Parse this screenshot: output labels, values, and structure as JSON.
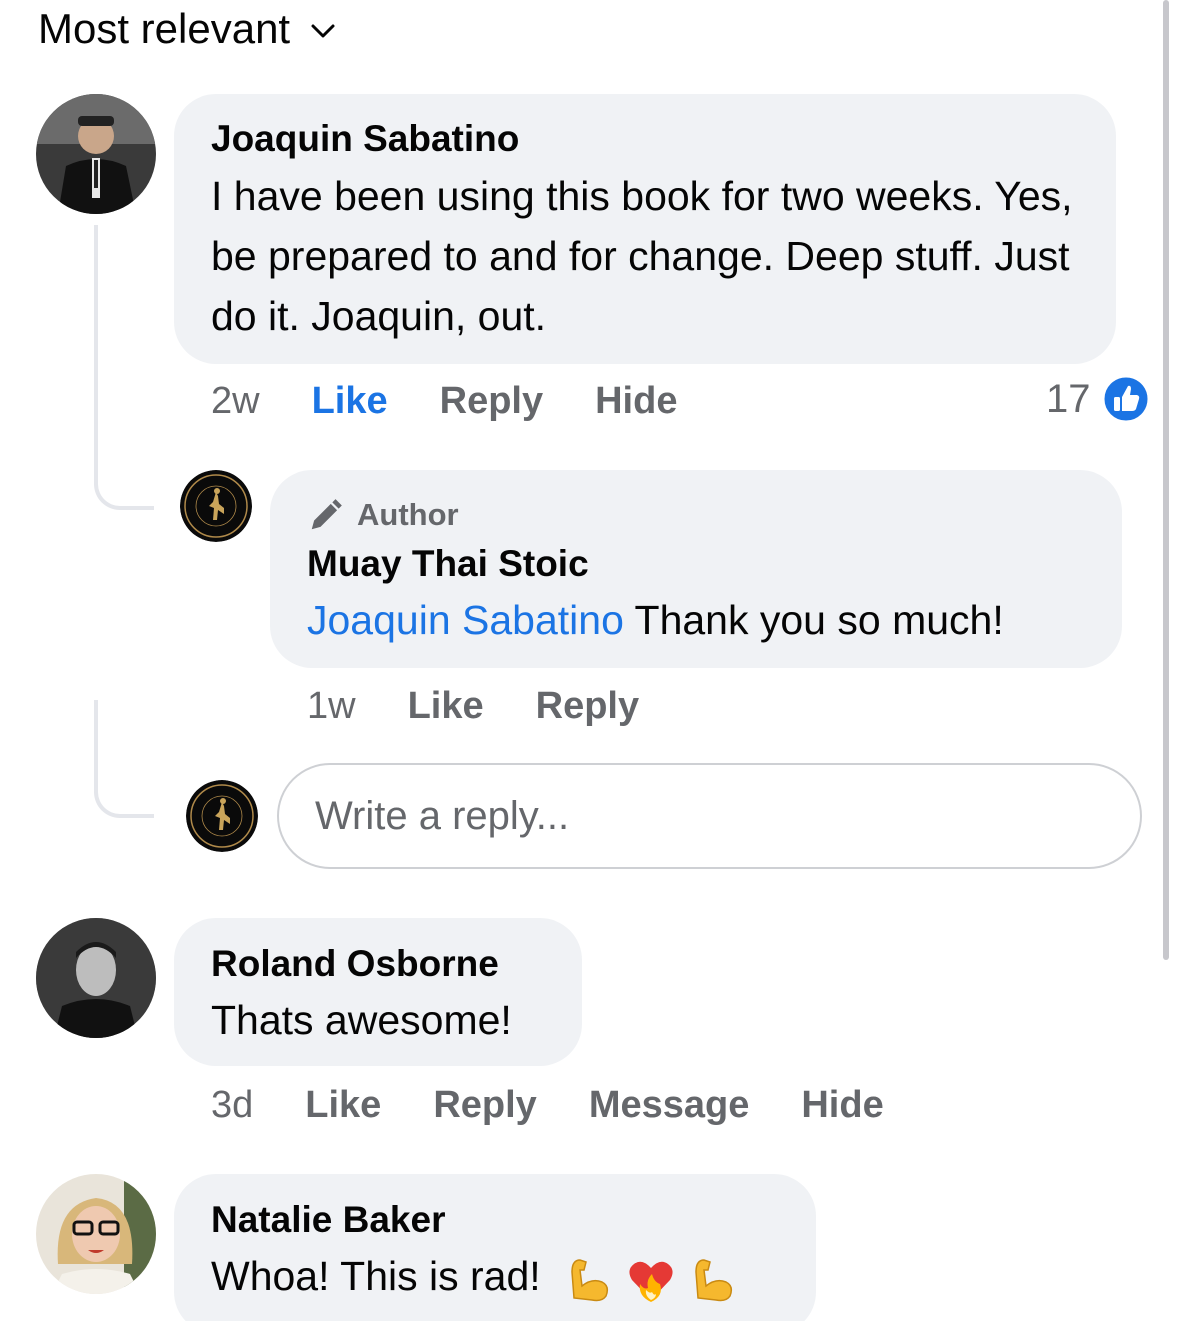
{
  "sort": {
    "label": "Most relevant"
  },
  "comments": [
    {
      "author": "Joaquin Sabatino",
      "text": "I have been using this book for two weeks. Yes, be prepared to and for change. Deep stuff. Just do it. Joaquin, out.",
      "time": "2w",
      "like_label": "Like",
      "reply_label": "Reply",
      "hide_label": "Hide",
      "reaction_count": "17",
      "reply": {
        "badge": "Author",
        "author": "Muay Thai Stoic",
        "mention": "Joaquin Sabatino",
        "text": "Thank you so much!",
        "time": "1w",
        "like_label": "Like",
        "reply_label": "Reply"
      },
      "reply_input": {
        "placeholder": "Write a reply..."
      }
    },
    {
      "author": "Roland Osborne",
      "text": "Thats awesome!",
      "time": "3d",
      "like_label": "Like",
      "reply_label": "Reply",
      "message_label": "Message",
      "hide_label": "Hide"
    },
    {
      "author": "Natalie Baker",
      "text": "Whoa! This is rad!",
      "emojis": [
        "flexed-biceps",
        "heart-on-fire",
        "flexed-biceps"
      ]
    }
  ],
  "colors": {
    "accent": "#1b74e4",
    "bubble": "#f0f2f5",
    "muted": "#65676b"
  }
}
